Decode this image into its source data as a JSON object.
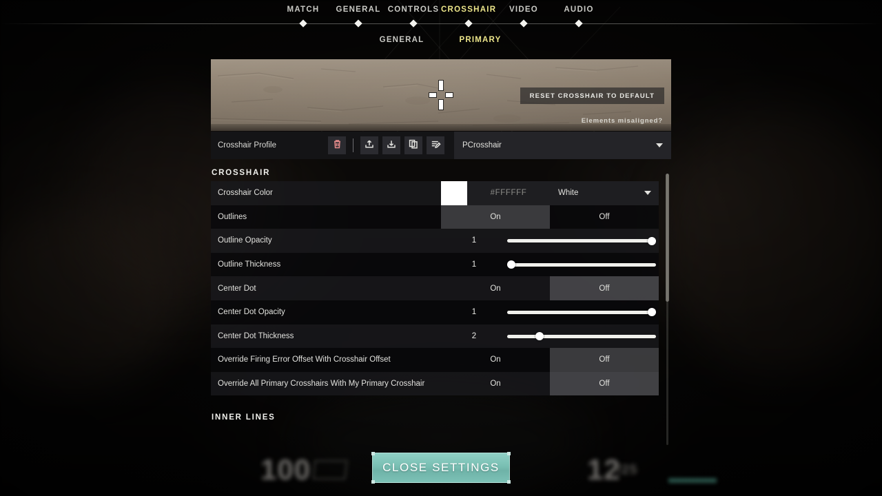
{
  "nav": {
    "tabs": [
      {
        "label": "MATCH",
        "active": false
      },
      {
        "label": "GENERAL",
        "active": false
      },
      {
        "label": "CONTROLS",
        "active": false
      },
      {
        "label": "CROSSHAIR",
        "active": true
      },
      {
        "label": "VIDEO",
        "active": false
      },
      {
        "label": "AUDIO",
        "active": false
      }
    ],
    "subtabs": [
      {
        "label": "GENERAL",
        "active": false
      },
      {
        "label": "PRIMARY",
        "active": true
      }
    ]
  },
  "preview": {
    "reset_label": "RESET CROSSHAIR TO DEFAULT",
    "misaligned_label": "Elements misaligned?"
  },
  "profile": {
    "label": "Crosshair Profile",
    "selected": "PCrosshair",
    "icons": [
      {
        "name": "delete-icon"
      },
      {
        "name": "upload-icon"
      },
      {
        "name": "download-icon"
      },
      {
        "name": "copy-icon"
      },
      {
        "name": "rename-icon"
      }
    ]
  },
  "sections": {
    "crosshair": "CROSSHAIR",
    "inner_lines": "INNER LINES"
  },
  "settings": {
    "crosshair_color": {
      "label": "Crosshair Color",
      "swatch_hex": "#FFFFFF",
      "hex_value": "#FFFFFF",
      "color_name": "White"
    },
    "outlines": {
      "label": "Outlines",
      "on_label": "On",
      "off_label": "Off",
      "value": "On"
    },
    "outline_opacity": {
      "label": "Outline Opacity",
      "value": "1",
      "percent": 100
    },
    "outline_thickness": {
      "label": "Outline Thickness",
      "value": "1",
      "percent": 0
    },
    "center_dot": {
      "label": "Center Dot",
      "on_label": "On",
      "off_label": "Off",
      "value": "Off"
    },
    "center_dot_opacity": {
      "label": "Center Dot Opacity",
      "value": "1",
      "percent": 100
    },
    "center_dot_thickness": {
      "label": "Center Dot Thickness",
      "value": "2",
      "percent": 20
    },
    "override_firing_error": {
      "label": "Override Firing Error Offset With Crosshair Offset",
      "on_label": "On",
      "off_label": "Off",
      "value": "Off"
    },
    "override_all_primary": {
      "label": "Override All Primary Crosshairs With My Primary Crosshair",
      "on_label": "On",
      "off_label": "Off",
      "value": "Off"
    }
  },
  "footer": {
    "close_label": "CLOSE SETTINGS"
  },
  "hud": {
    "health": "100",
    "ammo": "12",
    "ammo_reserve": "/25"
  },
  "colors": {
    "accent_yellow": "#ECE58A",
    "close_button_teal": "#79BFB3",
    "panel_dark": "#141416",
    "delete_icon_red": "#E58B8B"
  }
}
